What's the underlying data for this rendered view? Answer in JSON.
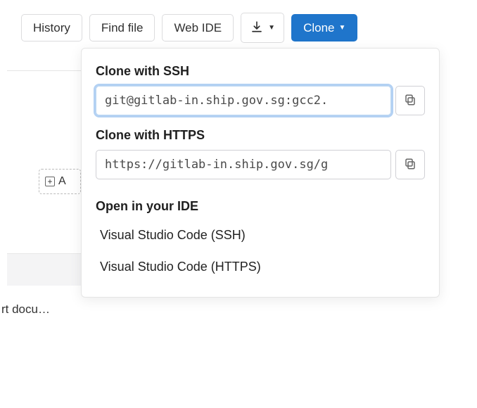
{
  "toolbar": {
    "history": "History",
    "find_file": "Find file",
    "web_ide": "Web IDE",
    "clone": "Clone"
  },
  "clone_panel": {
    "ssh_label": "Clone with SSH",
    "ssh_url": "git@gitlab-in.ship.gov.sg:gcc2.",
    "https_label": "Clone with HTTPS",
    "https_url": "https://gitlab-in.ship.gov.sg/g",
    "open_ide_label": "Open in your IDE",
    "ide_ssh": "Visual Studio Code (SSH)",
    "ide_https": "Visual Studio Code (HTTPS)"
  },
  "fragments": {
    "add_partial": "A",
    "bottom_text": "rt docu…",
    "right_g": "g"
  },
  "icons": {
    "download": "download-icon",
    "copy": "copy-icon",
    "plus": "+"
  }
}
